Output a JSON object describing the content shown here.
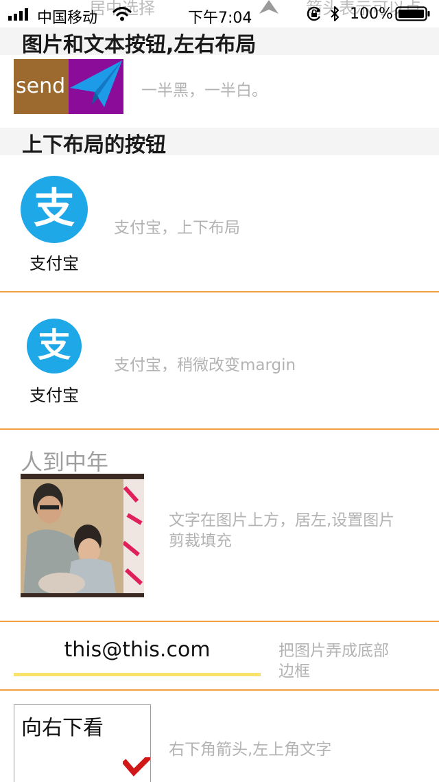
{
  "status_bar": {
    "carrier": "中国移动",
    "time": "下午7:04",
    "battery": "100%",
    "ghost_left": "居中选择",
    "ghost_right": "箭头表示可以点"
  },
  "sections": {
    "image_text_title": "图片和文本按钮,左右布局",
    "vertical_title": "上下布局的按钮"
  },
  "send_button": {
    "label": "send",
    "left_color": "#9c6a2e",
    "right_color": "#8a0c98",
    "icon_color": "#1d9be8"
  },
  "row_send": {
    "desc": "一半黑，一半白。"
  },
  "row_alipay_1": {
    "label": "支付宝",
    "desc": "支付宝，上下布局",
    "icon_glyph": "支"
  },
  "row_alipay_2": {
    "label": "支付宝",
    "desc": "支付宝，稍微改变margin",
    "icon_glyph": "支"
  },
  "row_poster": {
    "title": "人到中年",
    "desc_line1": "文字在图片上方，居左,设置图片",
    "desc_line2": "剪裁填充"
  },
  "row_email": {
    "value": "this@this.com",
    "desc_line1": "把图片弄成底部",
    "desc_line2": "边框",
    "border_color": "#f8e26a"
  },
  "row_arrow": {
    "label": "向右下看",
    "desc": "右下角箭头,左上角文字",
    "arrow_color": "#d01818"
  },
  "colors": {
    "alipay_blue": "#1ea8e8",
    "divider": "#f0a040",
    "desc_text": "#b3b3b3"
  }
}
